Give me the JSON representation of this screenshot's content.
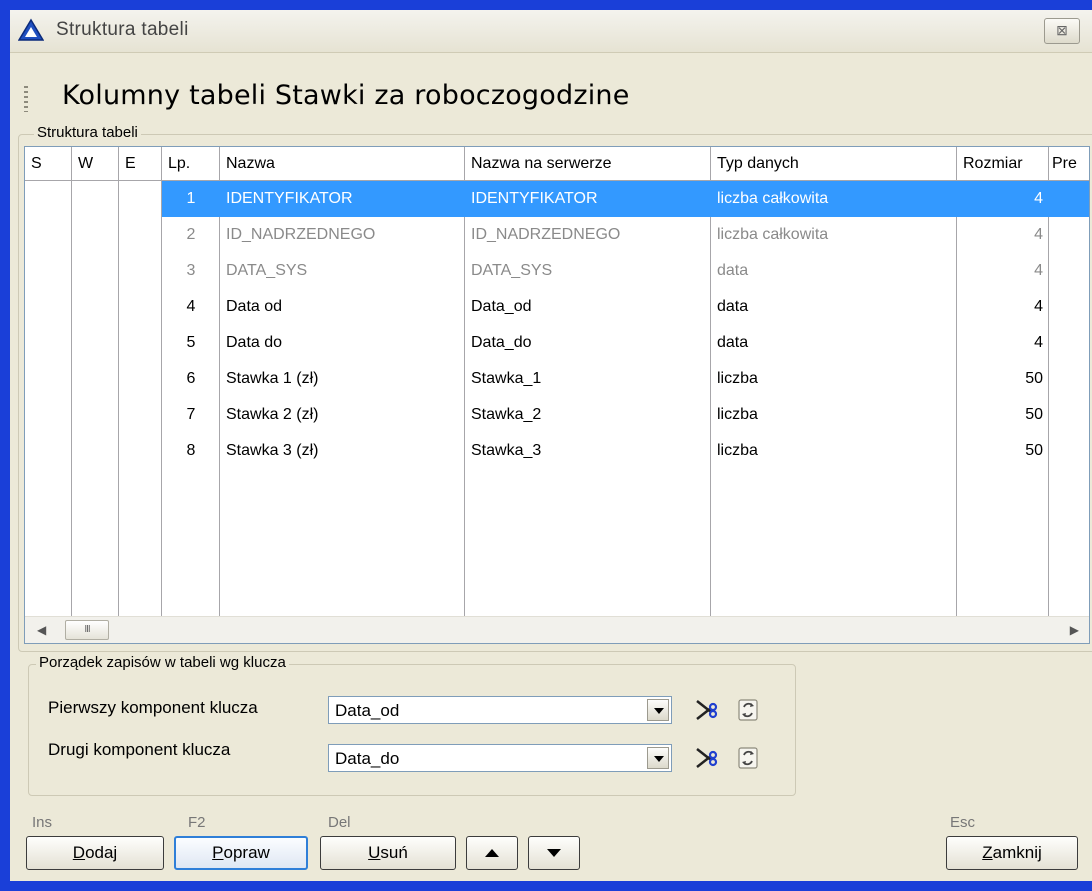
{
  "window": {
    "title": "Struktura tabeli",
    "close_glyph": "⊠"
  },
  "heading": "Kolumny tabeli Stawki za roboczogodzine",
  "structure_group": {
    "label": "Struktura tabeli"
  },
  "grid": {
    "columns": [
      "S",
      "W",
      "E",
      "Lp.",
      "Nazwa",
      "Nazwa na serwerze",
      "Typ danych",
      "Rozmiar",
      "Pre"
    ],
    "rows": [
      {
        "lp": "1",
        "nazwa": "IDENTYFIKATOR",
        "serwer": "IDENTYFIKATOR",
        "typ": "liczba całkowita",
        "rozmiar": "4",
        "state": "selected"
      },
      {
        "lp": "2",
        "nazwa": "ID_NADRZEDNEGO",
        "serwer": "ID_NADRZEDNEGO",
        "typ": "liczba całkowita",
        "rozmiar": "4",
        "state": "system"
      },
      {
        "lp": "3",
        "nazwa": "DATA_SYS",
        "serwer": "DATA_SYS",
        "typ": "data",
        "rozmiar": "4",
        "state": "system"
      },
      {
        "lp": "4",
        "nazwa": "Data od",
        "serwer": "Data_od",
        "typ": "data",
        "rozmiar": "4",
        "state": "normal"
      },
      {
        "lp": "5",
        "nazwa": "Data do",
        "serwer": "Data_do",
        "typ": "data",
        "rozmiar": "4",
        "state": "normal"
      },
      {
        "lp": "6",
        "nazwa": "Stawka 1 (zł)",
        "serwer": "Stawka_1",
        "typ": "liczba",
        "rozmiar": "50",
        "state": "normal"
      },
      {
        "lp": "7",
        "nazwa": "Stawka 2 (zł)",
        "serwer": "Stawka_2",
        "typ": "liczba",
        "rozmiar": "50",
        "state": "normal"
      },
      {
        "lp": "8",
        "nazwa": "Stawka 3 (zł)",
        "serwer": "Stawka_3",
        "typ": "liczba",
        "rozmiar": "50",
        "state": "normal"
      }
    ],
    "scroll_thumb_glyph": "III"
  },
  "key_group": {
    "label": "Porządek zapisów w tabeli wg klucza",
    "first_label": "Pierwszy komponent klucza",
    "first_value": "Data_od",
    "second_label": "Drugi komponent klucza",
    "second_value": "Data_do"
  },
  "buttons": {
    "add": {
      "hint": "Ins",
      "accel": "D",
      "rest": "odaj"
    },
    "edit": {
      "hint": "F2",
      "accel": "P",
      "rest": "opraw"
    },
    "delete": {
      "hint": "Del",
      "accel": "U",
      "rest": "suń"
    },
    "close": {
      "hint": "Esc",
      "accel": "Z",
      "rest": "amknij"
    }
  },
  "colors": {
    "selection": "#3399ff",
    "dialog_bg": "#ece9d8",
    "desktop": "#1a3fd8"
  }
}
